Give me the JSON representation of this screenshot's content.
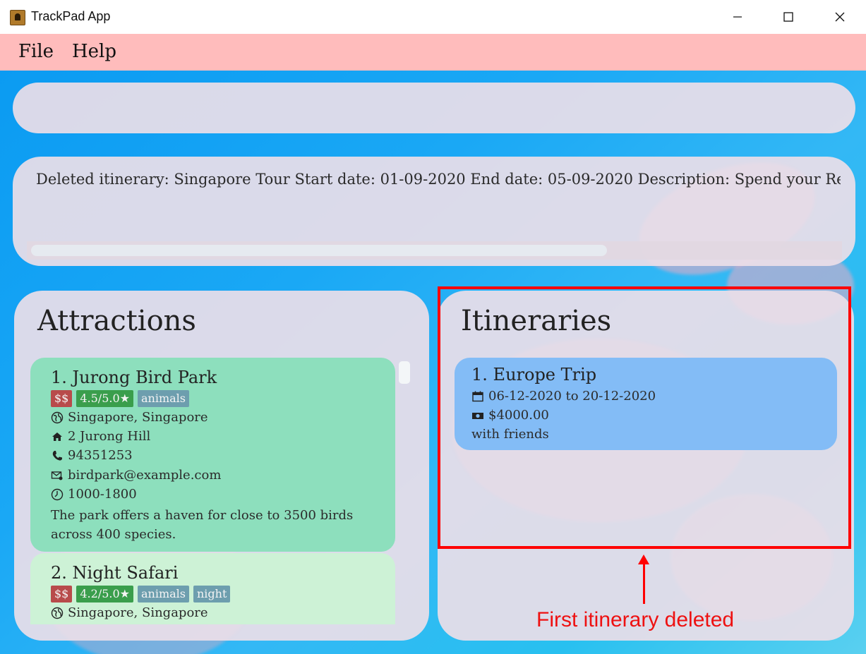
{
  "window": {
    "title": "TrackPad App"
  },
  "menu": {
    "file": "File",
    "help": "Help"
  },
  "command_box": {
    "value": ""
  },
  "result_box": {
    "text": "Deleted itinerary: Singapore Tour Start date: 01-09-2020 End date: 05-09-2020 Description: Spend your Rediscover"
  },
  "attractions": {
    "heading": "Attractions",
    "items": [
      {
        "index": "1.",
        "name": "Jurong Bird Park",
        "price": "$$",
        "rating": "4.5/5.0★",
        "tags": [
          "animals"
        ],
        "location": "Singapore, Singapore",
        "address": "2 Jurong Hill",
        "phone": "94351253",
        "email": "birdpark@example.com",
        "hours": "1000-1800",
        "description": "The park offers a haven for close to 3500 birds across 400 species."
      },
      {
        "index": "2.",
        "name": "Night Safari",
        "price": "$$",
        "rating": "4.2/5.0★",
        "tags": [
          "animals",
          "night"
        ],
        "location": "Singapore, Singapore"
      }
    ]
  },
  "itineraries": {
    "heading": "Itineraries",
    "items": [
      {
        "index": "1.",
        "name": "Europe Trip",
        "dates": "06-12-2020 to 20-12-2020",
        "budget": "$4000.00",
        "description": "with friends"
      }
    ]
  },
  "annotation": {
    "text": "First itinerary deleted",
    "color": "#ff0000"
  },
  "colors": {
    "menubar": "#ffbcbc",
    "attraction_card_1": "#8ddfbd",
    "attraction_card_2": "#cdf2d6",
    "itinerary_card": "#83bcf6",
    "price_badge": "#b84b4b",
    "rating_badge": "#3a9e4c",
    "tag_badge": "#6d9eae"
  },
  "icons": [
    "app-icon",
    "minimize-icon",
    "maximize-icon",
    "close-icon",
    "globe-icon",
    "home-icon",
    "phone-icon",
    "email-icon",
    "clock-icon",
    "calendar-icon",
    "money-icon"
  ]
}
